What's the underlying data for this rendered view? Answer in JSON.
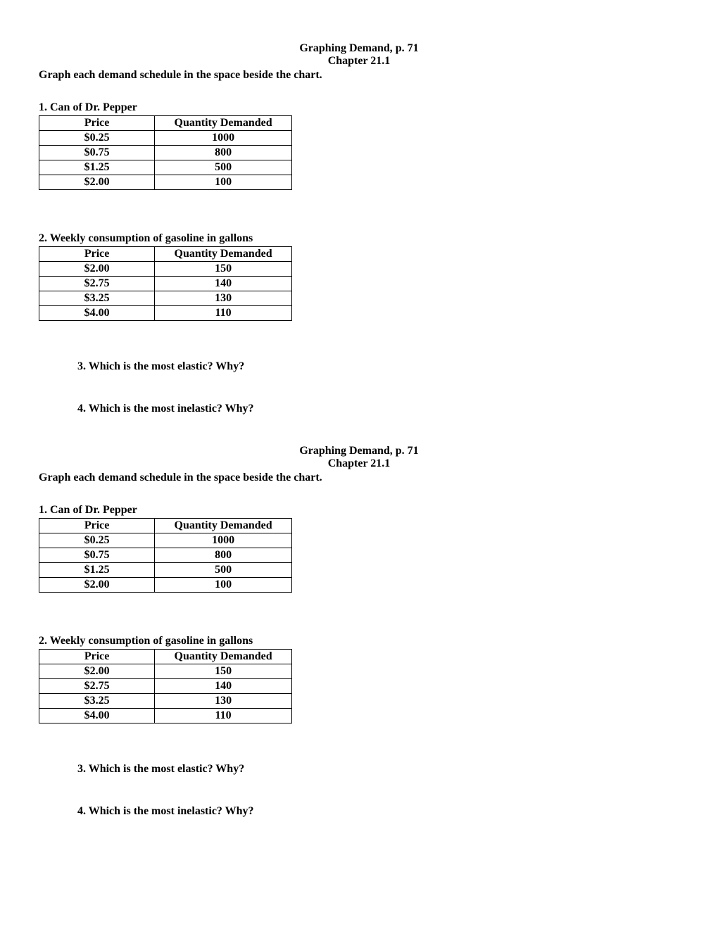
{
  "header": {
    "title": "Graphing Demand, p. 71",
    "subtitle": "Chapter 21.1",
    "instruction": "Graph each demand schedule in the space beside the chart."
  },
  "section1": {
    "title": "1.  Can of Dr. Pepper",
    "headers": {
      "price": "Price",
      "qty": "Quantity Demanded"
    },
    "rows": [
      {
        "price": "$0.25",
        "qty": "1000"
      },
      {
        "price": "$0.75",
        "qty": "800"
      },
      {
        "price": "$1.25",
        "qty": "500"
      },
      {
        "price": "$2.00",
        "qty": "100"
      }
    ]
  },
  "section2": {
    "title": "2. Weekly consumption of gasoline in gallons",
    "headers": {
      "price": "Price",
      "qty": "Quantity Demanded"
    },
    "rows": [
      {
        "price": "$2.00",
        "qty": "150"
      },
      {
        "price": "$2.75",
        "qty": "140"
      },
      {
        "price": "$3.25",
        "qty": "130"
      },
      {
        "price": "$4.00",
        "qty": "110"
      }
    ]
  },
  "questions": {
    "q3": "3.   Which is the most elastic?  Why?",
    "q4": "4.   Which is the most inelastic?  Why?"
  },
  "chart_data": [
    {
      "type": "table",
      "title": "Can of Dr. Pepper — Demand Schedule",
      "xlabel": "Price",
      "ylabel": "Quantity Demanded",
      "categories": [
        "$0.25",
        "$0.75",
        "$1.25",
        "$2.00"
      ],
      "values": [
        1000,
        800,
        500,
        100
      ]
    },
    {
      "type": "table",
      "title": "Weekly consumption of gasoline in gallons — Demand Schedule",
      "xlabel": "Price",
      "ylabel": "Quantity Demanded",
      "categories": [
        "$2.00",
        "$2.75",
        "$3.25",
        "$4.00"
      ],
      "values": [
        150,
        140,
        130,
        110
      ]
    }
  ]
}
